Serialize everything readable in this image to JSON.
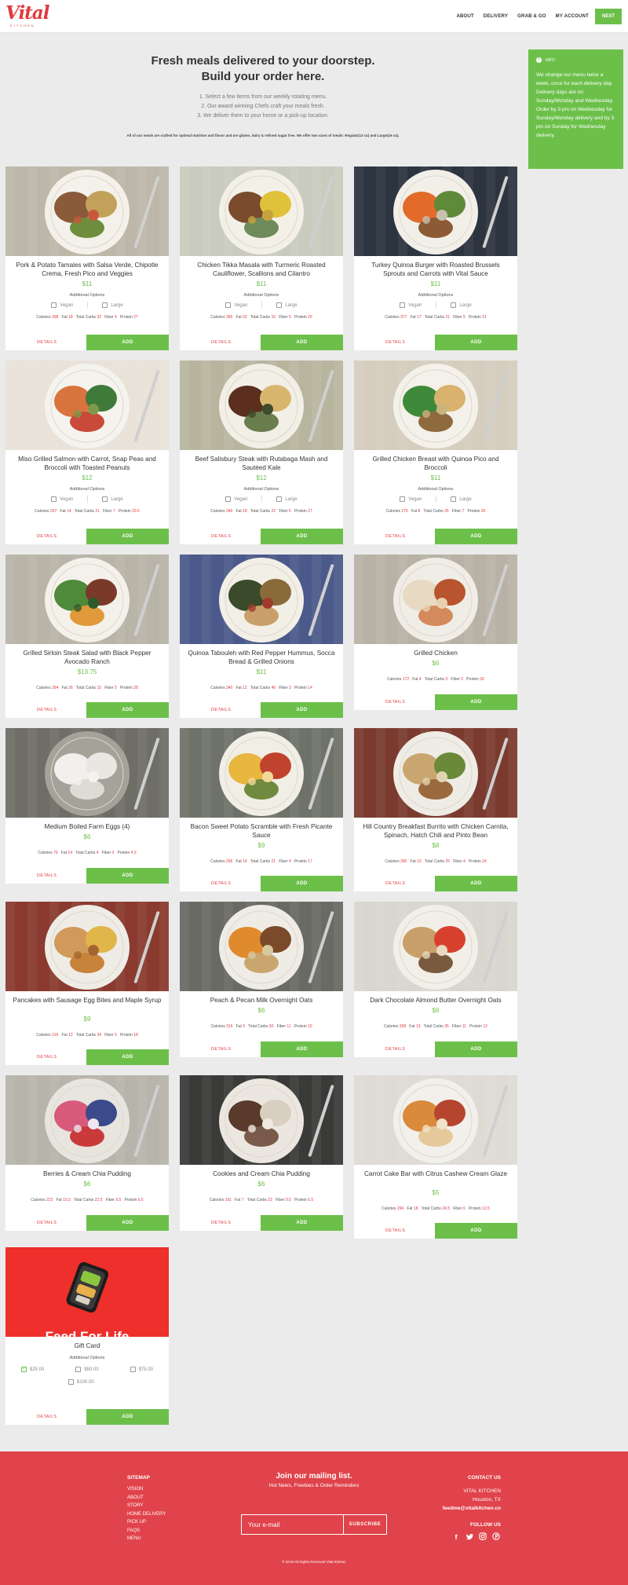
{
  "header": {
    "logo": "Vital",
    "logo_sub": "KITCHEN",
    "nav": [
      "ABOUT",
      "DELIVERY",
      "GRAB & GO",
      "MY ACCOUNT"
    ],
    "next_label": "NEXT"
  },
  "intro": {
    "title_line1": "Fresh meals delivered to your doorstep.",
    "title_line2": "Build your order here.",
    "steps": [
      "1. Select a few items from our weekly rotating menu.",
      "2. Our award winning Chefs craft your meals fresh.",
      "3. We deliver them to your home or a pick-up location."
    ],
    "note": "All of our meals are crafted for optimal nutrition and flavor and are gluten, dairy & refined sugar free. We offer two sizes of meals: Regular(12 oz) and Large(16 oz)."
  },
  "info": {
    "heading": "INFO",
    "text": "We change our menu twice a week, once for each delivery day. Delivery days are on Sunday/Monday and Wednesday. Order by 3 pm on Wednesday for Sunday/Monday delivery and by 3 pm on Sunday for Wednesday delivery."
  },
  "labels": {
    "options": "Additional Options",
    "vegan": "Vegan",
    "large": "Large",
    "details": "DETAILS",
    "add": "ADD",
    "calories": "Calories",
    "fat": "Fat",
    "carbs": "Total Carbs",
    "fiber": "Fiber",
    "protein": "Protein"
  },
  "meals": [
    {
      "name": "Pork & Potato Tamales with Salsa Verde, Chipotle Crema, Fresh Pico and Veggies",
      "price": "$11",
      "calories": "398",
      "fat": "18",
      "carbs": "32",
      "fiber": "4",
      "protein": "27",
      "options": true
    },
    {
      "name": "Chicken Tikka Masala with Turmeric Roasted Cauliflower, Scallions and Cilantro",
      "price": "$11",
      "calories": "366",
      "fat": "22",
      "carbs": "16",
      "fiber": "5",
      "protein": "26",
      "options": true
    },
    {
      "name": "Turkey Quinoa Burger with Roasted Brussels Sprouts and Carrots with Vital Sauce",
      "price": "$11",
      "calories": "377",
      "fat": "17",
      "carbs": "21",
      "fiber": "5",
      "protein": "31",
      "options": true
    },
    {
      "name": "Miso Grilled Salmon with Carrot, Snap Peas and Broccoli with Toasted Peanuts",
      "price": "$12",
      "calories": "297",
      "fat": "14",
      "carbs": "21",
      "fiber": "7",
      "protein": "29.5",
      "options": true
    },
    {
      "name": "Beef Salisbury Steak with Rutabaga Mash and Sautéed Kale",
      "price": "$12",
      "calories": "340",
      "fat": "18",
      "carbs": "22",
      "fiber": "5",
      "protein": "27",
      "options": true
    },
    {
      "name": "Grilled Chicken Breast with Quinoa Pico and Broccoli",
      "price": "$11",
      "calories": "275",
      "fat": "8",
      "carbs": "26",
      "fiber": "7",
      "protein": "26",
      "options": true
    },
    {
      "name": "Grilled Sirloin Steak Salad with Black Pepper Avocado Ranch",
      "price": "$13.75",
      "calories": "394",
      "fat": "26",
      "carbs": "15",
      "fiber": "5",
      "protein": "28",
      "options": false
    },
    {
      "name": "Quinoa Tabouleh with Red Pepper Hummus, Socca Bread & Grilled Onions",
      "price": "$11",
      "calories": "340",
      "fat": "12",
      "carbs": "46",
      "fiber": "3",
      "protein": "14",
      "options": false
    },
    {
      "name": "Grilled Chicken",
      "price": "$6",
      "calories": "172",
      "fat": "4",
      "carbs": "0",
      "fiber": "0",
      "protein": "32",
      "options": false
    },
    {
      "name": "Medium Boiled Farm Eggs (4)",
      "price": "$6",
      "calories": "76",
      "fat": "14",
      "carbs": "4",
      "fiber": "0",
      "protein": "4.3",
      "options": false
    },
    {
      "name": "Bacon Sweet Potato Scramble with Fresh Picante Sauce",
      "price": "$9",
      "calories": "296",
      "fat": "14",
      "carbs": "21",
      "fiber": "4",
      "protein": "17",
      "options": false
    },
    {
      "name": "Hill Country Breakfast Burrito with Chicken Carnita, Spinach, Hatch Chili and Pinto Bean",
      "price": "$8",
      "calories": "390",
      "fat": "10",
      "carbs": "25",
      "fiber": "4",
      "protein": "24",
      "options": false
    },
    {
      "name": "Pancakes with Sausage Egg Bites and Maple Syrup",
      "price": "$9",
      "calories": "316",
      "fat": "12",
      "carbs": "34",
      "fiber": "5",
      "protein": "18",
      "options": false
    },
    {
      "name": "Peach & Pecan Milk Overnight Oats",
      "price": "$6",
      "calories": "316",
      "fat": "5",
      "carbs": "50",
      "fiber": "11",
      "protein": "10",
      "options": false
    },
    {
      "name": "Dark Chocolate Almond Butter Overnight Oats",
      "price": "$6",
      "calories": "338",
      "fat": "13",
      "carbs": "35",
      "fiber": "11",
      "protein": "12",
      "options": false
    },
    {
      "name": "Berries & Cream Chia Pudding",
      "price": "$6",
      "calories": "223",
      "fat": "15.5",
      "carbs": "22.5",
      "fiber": "9.5",
      "protein": "6.5",
      "options": false
    },
    {
      "name": "Cookies and Cream Chia Pudding",
      "price": "$6",
      "calories": "191",
      "fat": "7",
      "carbs": "23",
      "fiber": "9.5",
      "protein": "6.5",
      "options": false
    },
    {
      "name": "Carrot Cake Bar with Citrus Cashew Cream Glaze",
      "price": "$5",
      "calories": "294",
      "fat": "18",
      "carbs": "24.5",
      "fiber": "6",
      "protein": "12.5",
      "options": false
    }
  ],
  "gift": {
    "banner": "Feed For Life",
    "name": "Gift Card",
    "options_label": "Additional Options",
    "amounts": [
      "$25.00",
      "$50.00",
      "$75.00",
      "$100.00"
    ],
    "selected": "$25.00"
  },
  "footer": {
    "sitemap_title": "SITEMAP",
    "sitemap": [
      "VISION",
      "ABOUT",
      "STORY",
      "HOME DELIVERY",
      "PICK UP",
      "FAQS",
      "MENU"
    ],
    "mail_title": "Join our mailing list.",
    "mail_sub": "Hot News, Freebies & Order Reminders",
    "email_placeholder": "Your e-mail",
    "subscribe": "SUBSCRIBE",
    "contact_title": "CONTACT US",
    "company": "VITAL KITCHEN",
    "city": "Houston, TX",
    "email": "feedme@vitalkitchen.co",
    "follow": "FOLLOW US",
    "social": [
      "facebook-icon",
      "twitter-icon",
      "instagram-icon",
      "pinterest-icon"
    ],
    "copyright": "© 2019 All Rights Reserved Vital Kitchen"
  },
  "colors": {
    "accent": "#6cc04a",
    "brand": "#e03a3e",
    "footer": "#e0434b"
  }
}
